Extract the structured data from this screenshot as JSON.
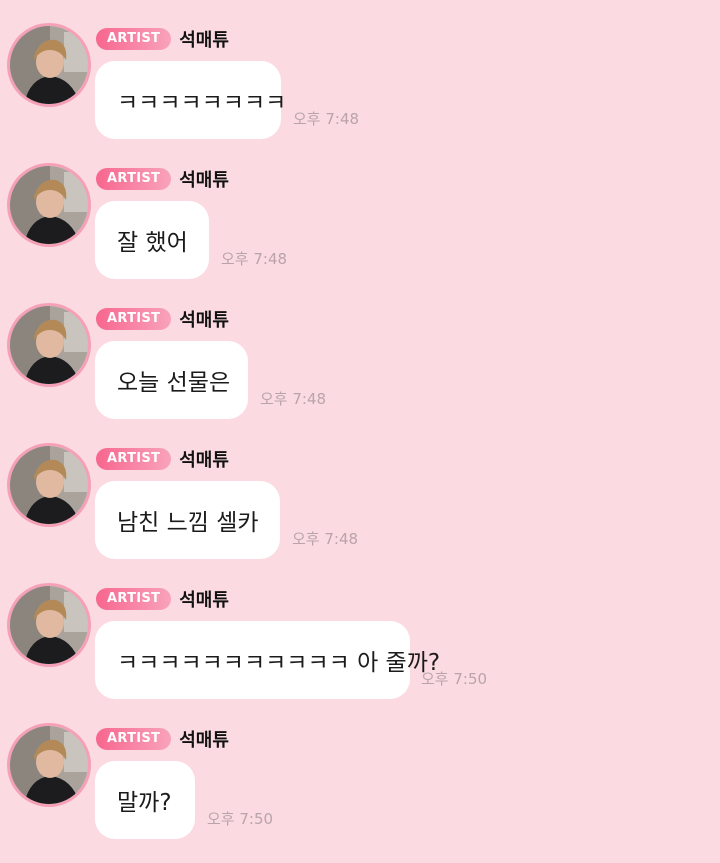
{
  "colors": {
    "background": "#fbdbe1",
    "bubble": "#ffffff",
    "badge_start": "#f7668f",
    "badge_end": "#f9a3bb",
    "avatar_ring": "#f6a0b8",
    "time_text": "#b8a4aa"
  },
  "messages": [
    {
      "badge": "ARTIST",
      "sender": "석매튜",
      "text": "ㅋㅋㅋㅋㅋㅋㅋㅋ",
      "time": "오후 7:48",
      "avatar_icon": "profile-photo"
    },
    {
      "badge": "ARTIST",
      "sender": "석매튜",
      "text": "잘 했어",
      "time": "오후 7:48",
      "avatar_icon": "profile-photo"
    },
    {
      "badge": "ARTIST",
      "sender": "석매튜",
      "text": "오늘 선물은",
      "time": "오후 7:48",
      "avatar_icon": "profile-photo"
    },
    {
      "badge": "ARTIST",
      "sender": "석매튜",
      "text": "남친 느낌 셀카",
      "time": "오후 7:48",
      "avatar_icon": "profile-photo"
    },
    {
      "badge": "ARTIST",
      "sender": "석매튜",
      "text": "ㅋㅋㅋㅋㅋㅋㅋㅋㅋㅋㅋ 아 줄까?",
      "time": "오후 7:50",
      "avatar_icon": "profile-photo"
    },
    {
      "badge": "ARTIST",
      "sender": "석매튜",
      "text": "말까?",
      "time": "오후 7:50",
      "avatar_icon": "profile-photo"
    }
  ]
}
